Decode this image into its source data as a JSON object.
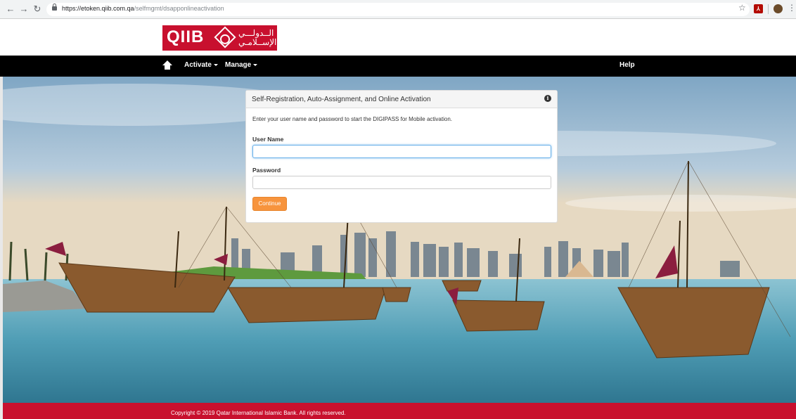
{
  "browser": {
    "url_host": "https://etoken.qiib.com.qa",
    "url_path": "/selfmgmt/dsapponlineactivation",
    "back_icon": "arrow-left-icon",
    "forward_icon": "arrow-right-icon",
    "reload_icon": "reload-icon",
    "star_icon": "star-icon",
    "menu_icon": "kebab-menu-icon"
  },
  "header": {
    "logo_text": "QIIB",
    "logo_arabic_line1": "الــدولـــي",
    "logo_arabic_line2": "الإســلامـي"
  },
  "nav": {
    "home_icon": "home-icon",
    "items": [
      {
        "label": "Activate"
      },
      {
        "label": "Manage"
      }
    ],
    "help": "Help"
  },
  "panel": {
    "title": "Self-Registration, Auto-Assignment, and Online Activation",
    "info_icon": "info-icon",
    "intro": "Enter your user name and password to start the DIGIPASS for Mobile activation.",
    "username_label": "User Name",
    "username_value": "",
    "password_label": "Password",
    "password_value": "",
    "continue_label": "Continue"
  },
  "footer": {
    "copyright": "Copyright © 2019 Qatar International Islamic Bank. All rights reserved."
  },
  "colors": {
    "brand_red": "#c8102e",
    "nav_black": "#000000",
    "button_orange": "#f7943d",
    "focus_blue": "#66afe9"
  }
}
